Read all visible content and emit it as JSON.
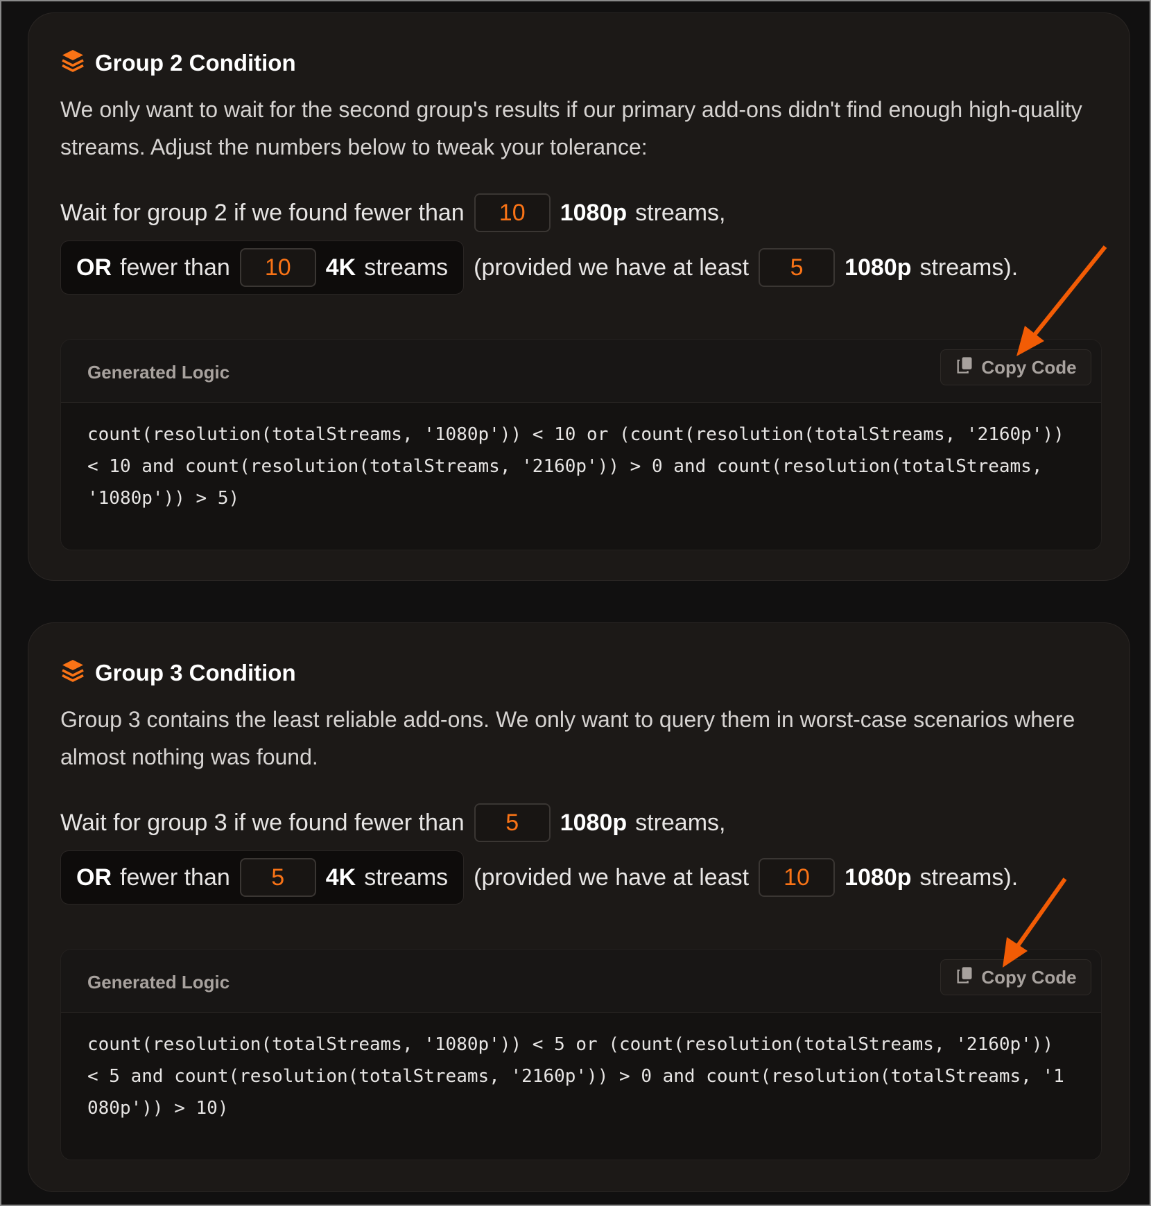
{
  "colors": {
    "accent": "#f97316",
    "background": "#111010",
    "card": "#1c1917"
  },
  "groups": [
    {
      "title": "Group 2 Condition",
      "icon": "layers-icon",
      "description": "We only want to wait for the second group's results if our primary add-ons didn't find enough high-quality streams. Adjust the numbers below to tweak your tolerance:",
      "row1": {
        "prefix": "Wait for group 2 if we found fewer than",
        "value": "10",
        "res": "1080p",
        "suffix": "streams,"
      },
      "row2": {
        "or_label": "OR",
        "or_text": "fewer than",
        "value_4k": "10",
        "res_4k": "4K",
        "streams": "streams",
        "provided": "(provided we have at least",
        "value_min": "5",
        "res_min": "1080p",
        "end": "streams)."
      },
      "code": {
        "label": "Generated Logic",
        "copy_label": "Copy Code",
        "text": "count(resolution(totalStreams, '1080p')) < 10 or (count(resolution(totalStreams, '2160p')) < 10 and count(resolution(totalStreams, '2160p')) > 0 and count(resolution(totalStreams, '1080p')) > 5)"
      }
    },
    {
      "title": "Group 3 Condition",
      "icon": "layers-icon",
      "description": "Group 3 contains the least reliable add-ons. We only want to query them in worst-case scenarios where almost nothing was found.",
      "row1": {
        "prefix": "Wait for group 3 if we found fewer than",
        "value": "5",
        "res": "1080p",
        "suffix": "streams,"
      },
      "row2": {
        "or_label": "OR",
        "or_text": "fewer than",
        "value_4k": "5",
        "res_4k": "4K",
        "streams": "streams",
        "provided": "(provided we have at least",
        "value_min": "10",
        "res_min": "1080p",
        "end": "streams)."
      },
      "code": {
        "label": "Generated Logic",
        "copy_label": "Copy Code",
        "text": "count(resolution(totalStreams, '1080p')) < 5 or (count(resolution(totalStreams, '2160p')) < 5 and count(resolution(totalStreams, '2160p')) > 0 and count(resolution(totalStreams, '1080p')) > 10)"
      }
    }
  ]
}
